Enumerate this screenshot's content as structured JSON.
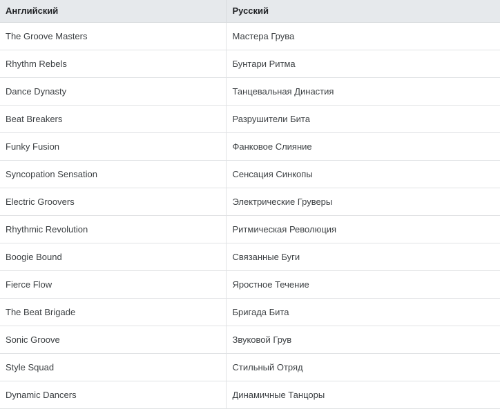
{
  "table": {
    "columns": [
      {
        "key": "en",
        "label": "Английский"
      },
      {
        "key": "ru",
        "label": "Русский"
      }
    ],
    "rows": [
      {
        "en": "The Groove Masters",
        "ru": "Мастера Грува"
      },
      {
        "en": "Rhythm Rebels",
        "ru": "Бунтари Ритма"
      },
      {
        "en": "Dance Dynasty",
        "ru": "Танцевальная Династия"
      },
      {
        "en": "Beat Breakers",
        "ru": "Разрушители Бита"
      },
      {
        "en": "Funky Fusion",
        "ru": "Фанковое Слияние"
      },
      {
        "en": "Syncopation Sensation",
        "ru": "Сенсация Синкопы"
      },
      {
        "en": "Electric Groovers",
        "ru": "Электрические Груверы"
      },
      {
        "en": "Rhythmic Revolution",
        "ru": "Ритмическая Революция"
      },
      {
        "en": "Boogie Bound",
        "ru": "Связанные Буги"
      },
      {
        "en": "Fierce Flow",
        "ru": "Яростное Течение"
      },
      {
        "en": "The Beat Brigade",
        "ru": "Бригада Бита"
      },
      {
        "en": "Sonic Groove",
        "ru": "Звуковой Грув"
      },
      {
        "en": "Style Squad",
        "ru": "Стильный Отряд"
      },
      {
        "en": "Dynamic Dancers",
        "ru": "Динамичные Танцоры"
      }
    ]
  },
  "colors": {
    "header_background": "#e6e9ec",
    "header_text": "#1f2124",
    "row_background": "#ffffff",
    "row_text": "#3c4043",
    "row_border": "#e0e2e4",
    "header_border": "#d7dadd"
  }
}
